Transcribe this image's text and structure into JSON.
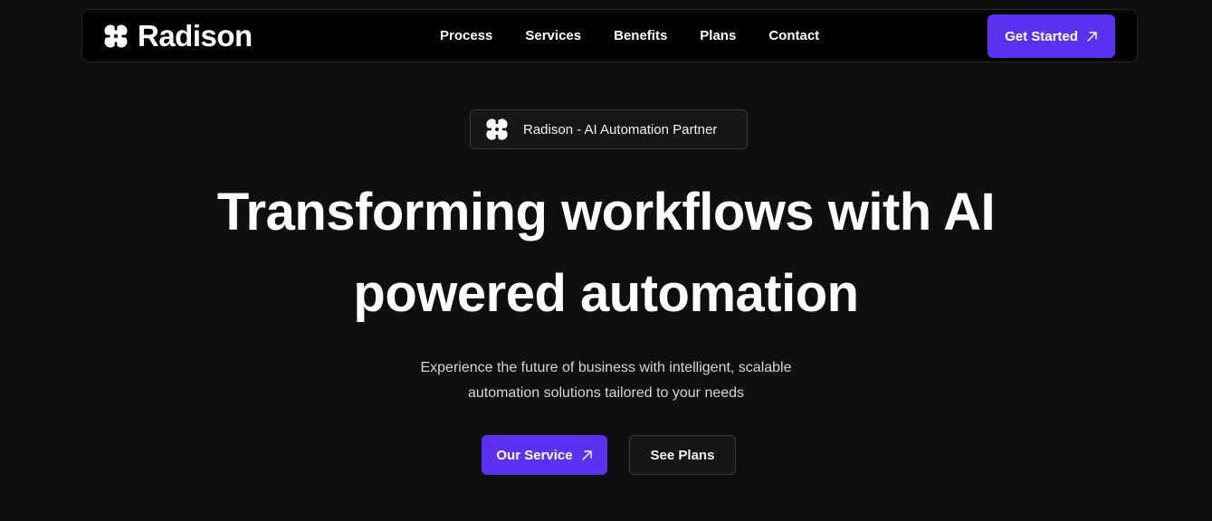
{
  "nav": {
    "brand": "Radison",
    "brand_icon": "clover-logo-icon",
    "links": [
      "Process",
      "Services",
      "Benefits",
      "Plans",
      "Contact"
    ],
    "cta_label": "Get Started",
    "cta_icon": "arrow-up-right-icon"
  },
  "hero": {
    "badge_icon": "clover-logo-icon",
    "badge_text": "Radison - AI Automation Partner",
    "headline_line1": "Transforming workflows with AI",
    "headline_line2": "powered automation",
    "subtext_line1": "Experience the future of business with intelligent, scalable",
    "subtext_line2": "automation solutions tailored to your needs",
    "primary_button": "Our Service",
    "primary_button_icon": "arrow-up-right-icon",
    "secondary_button": "See Plans"
  },
  "colors": {
    "background": "#0f0f0f",
    "nav_background": "#000000",
    "accent": "#5b32f2",
    "text": "#ffffff"
  }
}
